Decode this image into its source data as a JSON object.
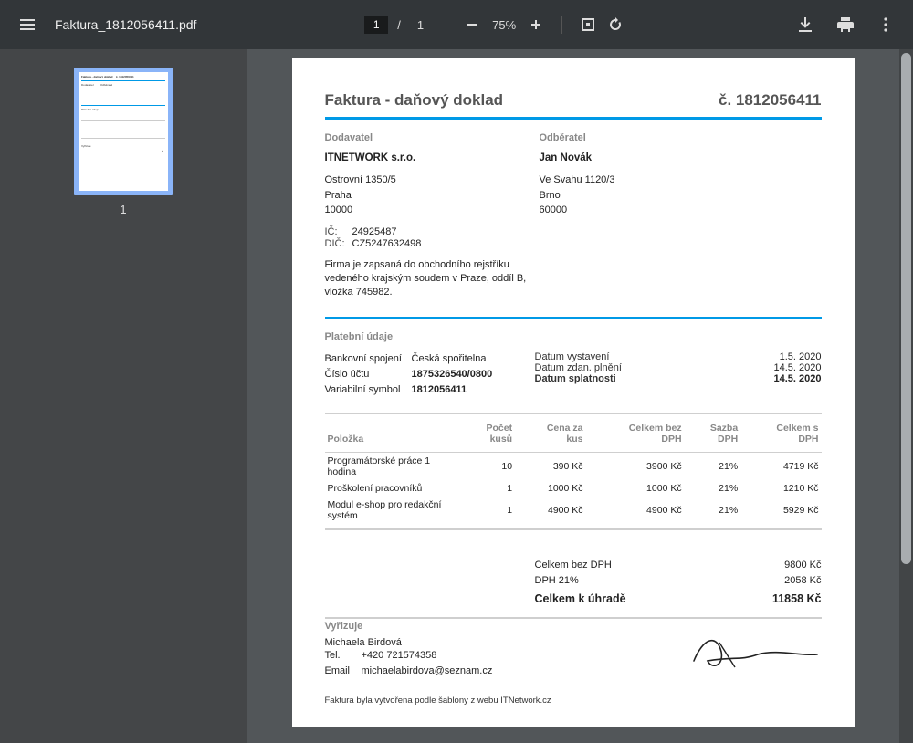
{
  "toolbar": {
    "filename": "Faktura_1812056411.pdf",
    "page_current": "1",
    "page_total": "1",
    "page_sep": "/",
    "zoom_pct": "75%",
    "thumb_current_num": "1"
  },
  "invoice": {
    "title": "Faktura - daňový doklad",
    "number_label": "č. 1812056411",
    "supplier": {
      "heading": "Dodavatel",
      "name": "ITNETWORK s.r.o.",
      "street": "Ostrovní 1350/5",
      "city": "Praha",
      "zip": "10000",
      "ico_label": "IČ:",
      "ico": "24925487",
      "dic_label": "DIČ:",
      "dic": "CZ5247632498",
      "note": "Firma je zapsaná do obchodního rejstříku vedeného krajským soudem v Praze, oddíl B, vložka 745982."
    },
    "buyer": {
      "heading": "Odběratel",
      "name": "Jan Novák",
      "street": "Ve Svahu 1120/3",
      "city": "Brno",
      "zip": "60000"
    },
    "payment": {
      "heading": "Platební údaje",
      "bank_label": "Bankovní spojení",
      "bank": "Česká spořitelna",
      "account_label": "Číslo účtu",
      "account": "1875326540/0800",
      "varsym_label": "Variabilní symbol",
      "varsym": "1812056411",
      "issue_label": "Datum vystavení",
      "issue": "1.5. 2020",
      "tax_label": "Datum zdan. plnění",
      "tax": "14.5. 2020",
      "due_label": "Datum splatnosti",
      "due": "14.5. 2020"
    },
    "table": {
      "cols": {
        "item": "Položka",
        "qty_l1": "Počet",
        "qty_l2": "kusů",
        "unit_l1": "Cena za",
        "unit_l2": "kus",
        "noVat_l1": "Celkem bez",
        "noVat_l2": "DPH",
        "rate_l1": "Sazba",
        "rate_l2": "DPH",
        "withVat_l1": "Celkem s",
        "withVat_l2": "DPH"
      },
      "rows": [
        {
          "item": "Programátorské práce 1 hodina",
          "qty": "10",
          "unit": "390 Kč",
          "noVat": "3900 Kč",
          "rate": "21%",
          "withVat": "4719 Kč"
        },
        {
          "item": "Proškolení pracovníků",
          "qty": "1",
          "unit": "1000 Kč",
          "noVat": "1000 Kč",
          "rate": "21%",
          "withVat": "1210 Kč"
        },
        {
          "item": "Modul e-shop pro redakční systém",
          "qty": "1",
          "unit": "4900 Kč",
          "noVat": "4900 Kč",
          "rate": "21%",
          "withVat": "5929 Kč"
        }
      ]
    },
    "totals": {
      "ex_vat_label": "Celkem bez DPH",
      "ex_vat": "9800 Kč",
      "vat_label": "DPH 21%",
      "vat": "2058 Kč",
      "grand_label": "Celkem k úhradě",
      "grand": "11858 Kč"
    },
    "contact": {
      "heading": "Vyřizuje",
      "name": "Michaela Birdová",
      "tel_label": "Tel.",
      "tel": "+420 721574358",
      "email_label": "Email",
      "email": "michaelabirdova@seznam.cz"
    },
    "footer": "Faktura byla vytvořena podle šablony z webu ITNetwork.cz"
  }
}
